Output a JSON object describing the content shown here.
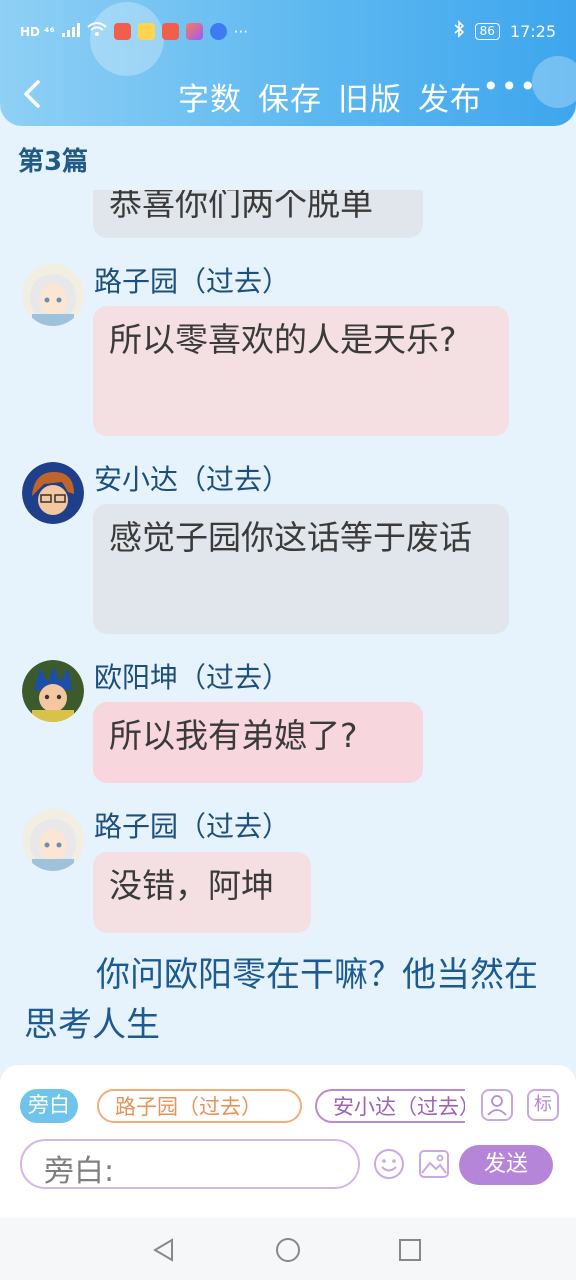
{
  "status_bar": {
    "left_text": "HD ⁴⁶",
    "battery": "86",
    "time": "17:25",
    "dots": "···"
  },
  "header": {
    "actions": [
      "字数",
      "保存",
      "旧版",
      "发布"
    ],
    "more": "•••"
  },
  "chapter_title": "第3篇",
  "messages": [
    {
      "speaker": "",
      "text": "恭喜你们两个脱单"
    },
    {
      "speaker": "路子园（过去）",
      "text": "所以零喜欢的人是天乐?"
    },
    {
      "speaker": "安小达（过去）",
      "text": "感觉子园你这话等于废话"
    },
    {
      "speaker": "欧阳坤（过去）",
      "text": "所以我有弟媳了?"
    },
    {
      "speaker": "路子园（过去）",
      "text": "没错，阿坤"
    }
  ],
  "narration": "你问欧阳零在干嘛？他当然在思考人生",
  "input": {
    "roles": [
      "旁白",
      "路子园（过去）",
      "安小达（过去）"
    ],
    "tag_label": "标",
    "placeholder": "旁白:",
    "send_label": "发送"
  },
  "colors": {
    "header_blue": "#5db8f0",
    "bubble_pink": "#f4dfe2",
    "bubble_gray": "#e1e6ec",
    "bubble_pink_strong": "#f7d6de",
    "name_blue": "#1d4f7c",
    "send_purple": "#b585d9"
  }
}
